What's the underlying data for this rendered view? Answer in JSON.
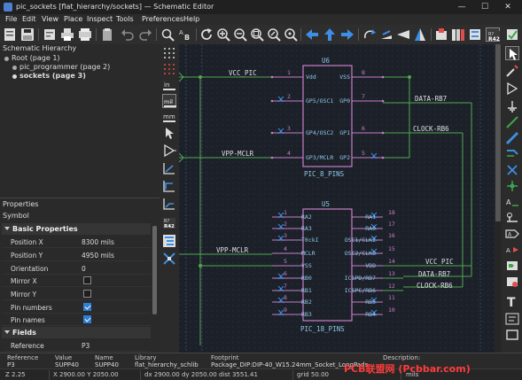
{
  "window": {
    "title": "pic_sockets [flat_hierarchy/sockets] — Schematic Editor"
  },
  "menu": [
    "File",
    "Edit",
    "View",
    "Place",
    "Inspect",
    "Tools",
    "Preferences",
    "Help"
  ],
  "hierarchy": {
    "title": "Schematic Hierarchy",
    "items": [
      {
        "label": "Root (page 1)"
      },
      {
        "label": "pic_programmer (page 2)"
      },
      {
        "label": "sockets (page 3)"
      }
    ]
  },
  "properties": {
    "title": "Properties",
    "subtitle": "Symbol",
    "group_basic": "Basic Properties",
    "rows": [
      {
        "key": "Position X",
        "value": "8300 mils"
      },
      {
        "key": "Position Y",
        "value": "4950 mils"
      },
      {
        "key": "Orientation",
        "value": "0"
      }
    ],
    "checks": [
      {
        "key": "Mirror X",
        "checked": false
      },
      {
        "key": "Mirror Y",
        "checked": false
      },
      {
        "key": "Pin numbers",
        "checked": true
      },
      {
        "key": "Pin names",
        "checked": true
      }
    ],
    "group_fields": "Fields",
    "field_rows": [
      {
        "key": "Reference",
        "value": "P3"
      }
    ]
  },
  "left_tool_labels": {
    "in": "in",
    "mil": "mil",
    "mm": "mm"
  },
  "schematic": {
    "u6": {
      "ref": "U6",
      "value": "PIC_8_PINS",
      "left_pins": [
        {
          "name": "Vdd",
          "num": "1"
        },
        {
          "name": "GP5/OSC1",
          "num": "2"
        },
        {
          "name": "GP4/OSC2",
          "num": "3"
        },
        {
          "name": "GP3/MCLR",
          "num": "4"
        }
      ],
      "right_pins": [
        {
          "name": "VSS",
          "num": "8"
        },
        {
          "name": "GP0",
          "num": "7"
        },
        {
          "name": "GP1",
          "num": "6"
        },
        {
          "name": "GP2",
          "num": "5"
        }
      ]
    },
    "u5": {
      "ref": "U5",
      "value": "PIC_18_PINS",
      "left_pins": [
        {
          "name": "RA2",
          "num": "1"
        },
        {
          "name": "RA3",
          "num": "2"
        },
        {
          "name": "T0ckI",
          "num": "3"
        },
        {
          "name": "MCLR",
          "num": "4"
        },
        {
          "name": "VSS",
          "num": "5"
        },
        {
          "name": "RB0",
          "num": "6"
        },
        {
          "name": "RB1",
          "num": "7"
        },
        {
          "name": "RB2",
          "num": "8"
        },
        {
          "name": "RB3",
          "num": "9"
        }
      ],
      "right_pins": [
        {
          "name": "RA1",
          "num": "18"
        },
        {
          "name": "RA0",
          "num": "17"
        },
        {
          "name": "OSC1/CLKI",
          "num": "16"
        },
        {
          "name": "OSC2/CLKO",
          "num": "15"
        },
        {
          "name": "VDD",
          "num": "14"
        },
        {
          "name": "ICSPD/RB7",
          "num": "13"
        },
        {
          "name": "ICSPC/RB6",
          "num": "12"
        },
        {
          "name": "RB5",
          "num": "11"
        },
        {
          "name": "RB4",
          "num": "10"
        }
      ]
    },
    "labels": {
      "vcc_pic_1": "VCC_PIC",
      "vpp_mclr_1": "VPP-MCLR",
      "data_rb7_1": "DATA-RB7",
      "clock_rb6_1": "CLOCK-RB6",
      "vpp_mclr_2": "VPP-MCLR",
      "vcc_pic_2": "VCC_PIC",
      "data_rb7_2": "DATA-RB7",
      "clock_rb6_2": "CLOCK-RB6"
    }
  },
  "info": {
    "reference_h": "Reference",
    "reference_v": "P3",
    "value_h": "Value",
    "value_v": "SUPP40",
    "name_h": "Name",
    "name_v": "SUPP40",
    "library_h": "Library",
    "library_v": "flat_hierarchy_schlib",
    "footprint_h": "Footprint",
    "footprint_v": "Package_DIP:DIP-40_W15.24mm_Socket_LongPads",
    "description_h": "Description:",
    "description_v": ""
  },
  "status": {
    "z": "Z 2.25",
    "xy": "X 2900.00  Y 2050.00",
    "dxdy": "dx 2900.00  dy 2050.00  dist 3551.41",
    "grid": "grid 50.00",
    "units": "mils"
  },
  "watermark": "PCB联盟网 (Pcbbar.com)",
  "colors": {
    "accent": "#2d7fd3",
    "canvas_bg": "#1c2029",
    "wire": "#4fa84f",
    "component": "#c87fc8",
    "text": "#e0e0e0",
    "watermark": "#ff3b3b"
  }
}
